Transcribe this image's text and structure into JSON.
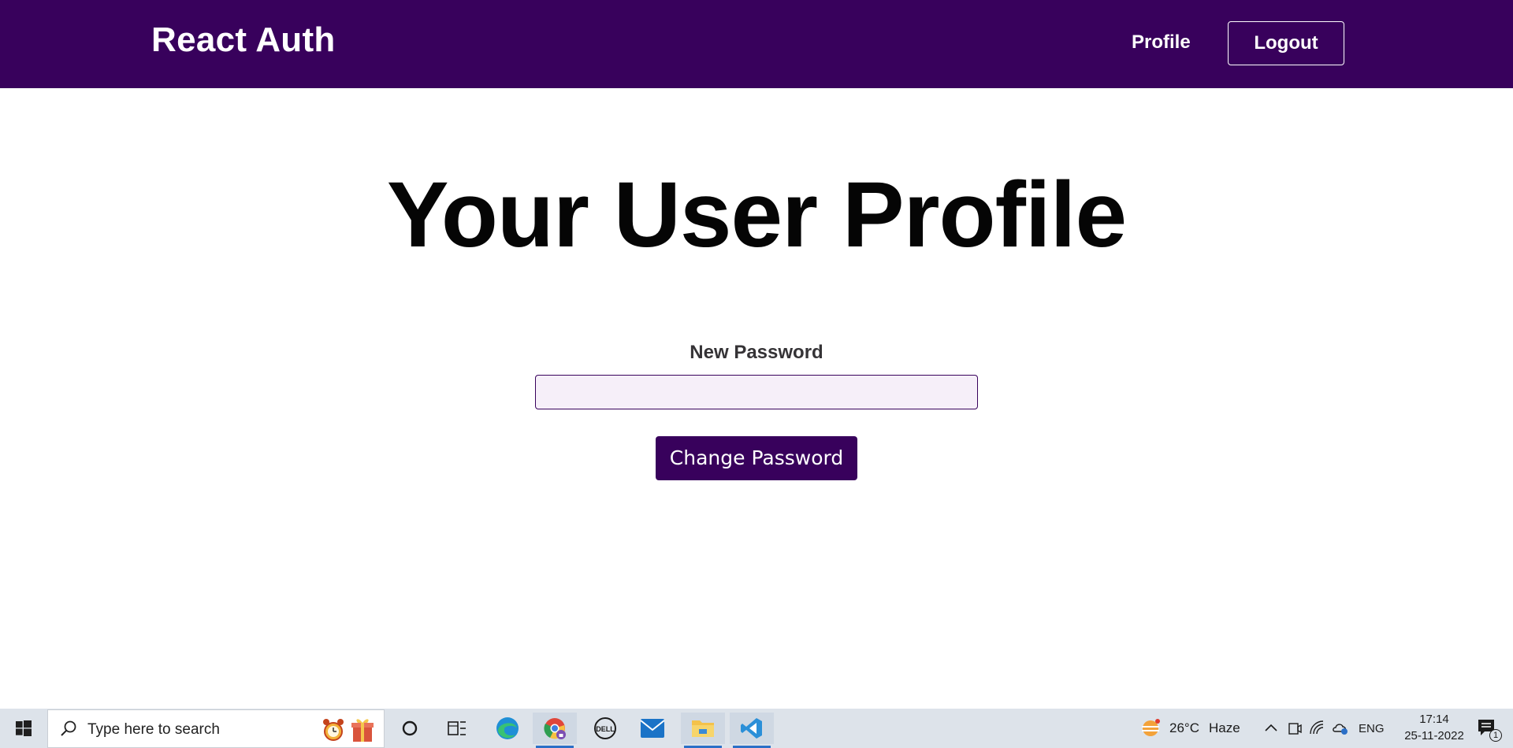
{
  "header": {
    "logo": "React Auth",
    "nav_profile": "Profile",
    "nav_logout": "Logout"
  },
  "main": {
    "title": "Your User Profile",
    "password_label": "New Password",
    "password_value": "",
    "submit_label": "Change Password"
  },
  "taskbar": {
    "search_placeholder": "Type here to search",
    "weather_temp": "26°C",
    "weather_desc": "Haze",
    "language": "ENG",
    "time": "17:14",
    "date": "25-11-2022",
    "notification_count": "1",
    "apps": [
      "cortana-icon",
      "task-view-icon",
      "edge-icon",
      "chrome-icon",
      "dell-icon",
      "mail-icon",
      "file-explorer-icon",
      "vscode-icon"
    ]
  },
  "colors": {
    "brand": "#38015c",
    "input_bg": "#f6eff9",
    "taskbar_bg": "#dde3ea"
  }
}
